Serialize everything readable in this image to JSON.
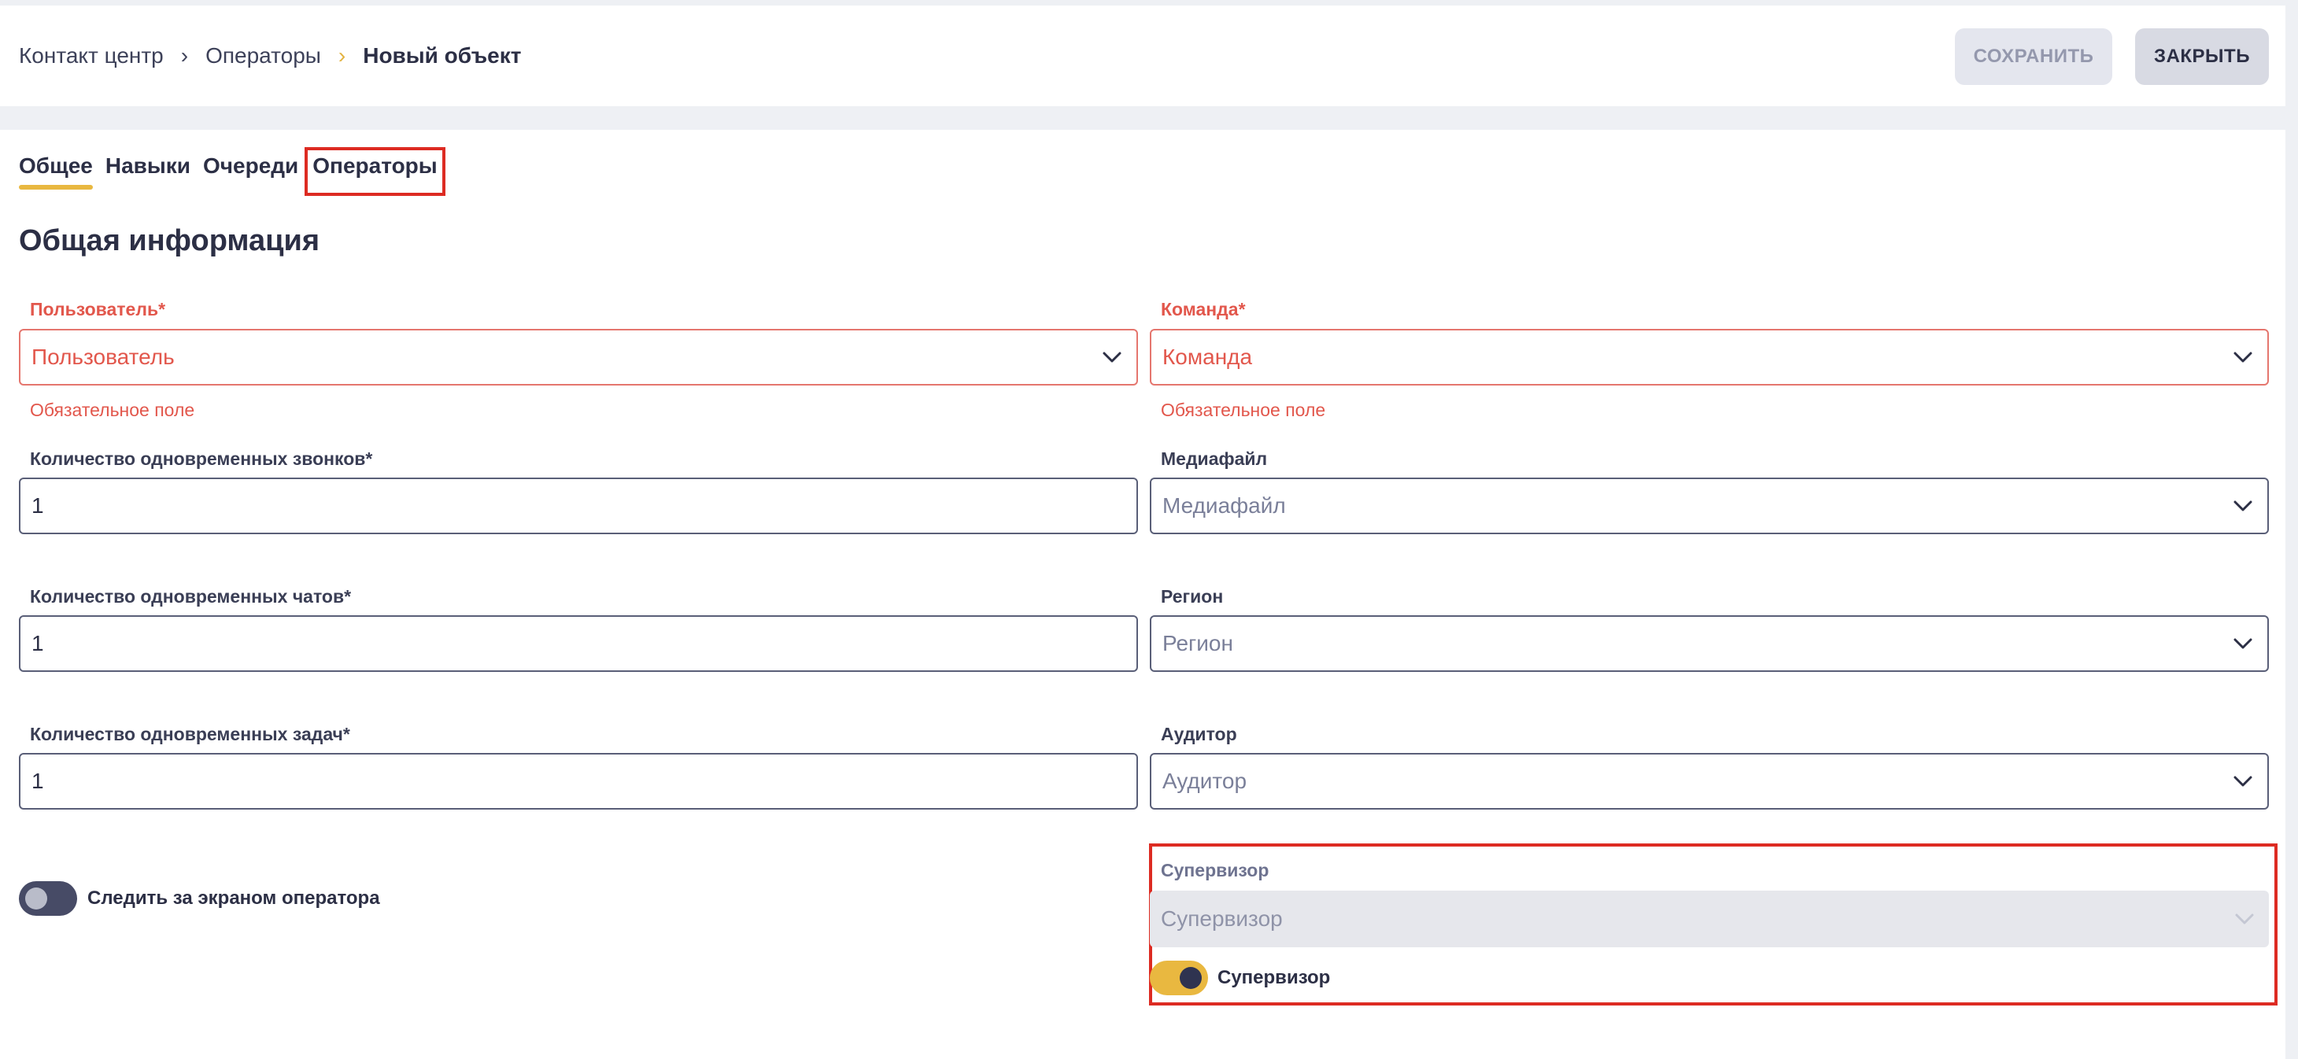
{
  "breadcrumb": {
    "items": [
      "Контакт центр",
      "Операторы"
    ],
    "current": "Новый объект",
    "separator": "›"
  },
  "toolbar": {
    "save_label": "СОХРАНИТЬ",
    "close_label": "ЗАКРЫТЬ"
  },
  "tabs": [
    {
      "label": "Общее"
    },
    {
      "label": "Навыки"
    },
    {
      "label": "Очереди"
    },
    {
      "label": "Операторы"
    }
  ],
  "section_title": "Общая информация",
  "fields": {
    "user": {
      "label": "Пользователь*",
      "placeholder": "Пользователь",
      "error": "Обязательное поле"
    },
    "team": {
      "label": "Команда*",
      "placeholder": "Команда",
      "error": "Обязательное поле"
    },
    "calls": {
      "label": "Количество одновременных звонков*",
      "value": "1"
    },
    "media": {
      "label": "Медиафайл",
      "placeholder": "Медиафайл"
    },
    "chats": {
      "label": "Количество одновременных чатов*",
      "value": "1"
    },
    "region": {
      "label": "Регион",
      "placeholder": "Регион"
    },
    "tasks": {
      "label": "Количество одновременных задач*",
      "value": "1"
    },
    "auditor": {
      "label": "Аудитор",
      "placeholder": "Аудитор"
    },
    "supervisor": {
      "label": "Супервизор",
      "placeholder": "Супервизор"
    }
  },
  "toggles": {
    "watch_screen": {
      "label": "Следить за экраном оператора",
      "checked": false
    },
    "supervisor": {
      "label": "Супервизор",
      "checked": true
    }
  },
  "colors": {
    "accent": "#e9b840",
    "error": "#e2574c",
    "highlight": "#dd2b22",
    "text": "#2c2f45"
  }
}
